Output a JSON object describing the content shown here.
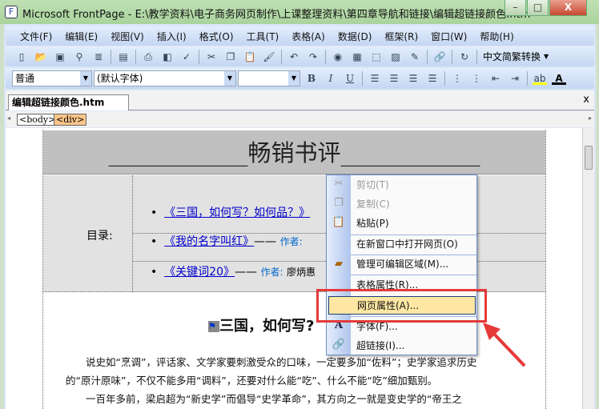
{
  "window": {
    "title": "Microsoft FrontPage - E:\\教学资料\\电子商务网页制作\\上课整理资料\\第四章导航和链接\\编辑超链接颜色.htm",
    "minimize": "–",
    "maximize": "□",
    "close": "X"
  },
  "menu": [
    "文件(F)",
    "编辑(E)",
    "视图(V)",
    "插入(I)",
    "格式(O)",
    "工具(T)",
    "表格(A)",
    "数据(D)",
    "框架(R)",
    "窗口(W)",
    "帮助(H)"
  ],
  "toolbar": {
    "convert_label": "中文简繁转换"
  },
  "format": {
    "style": "普通",
    "font": "(默认字体)",
    "size": "",
    "bold": "B",
    "italic": "I",
    "underline": "U"
  },
  "tab": {
    "label": "编辑超链接颜色.htm",
    "close": "x"
  },
  "tags": [
    "<body>",
    "<div>"
  ],
  "page": {
    "title": "____________畅销书评____________",
    "toc_label": "目录:",
    "links": [
      {
        "title": "《三国，如何写？如何品？》",
        "dash": "",
        "author_label": "",
        "author": ""
      },
      {
        "title": "《我的名字叫红》",
        "dash": "——",
        "author_label": "作者:",
        "author": ""
      },
      {
        "title": "《关键词20》",
        "dash": "——",
        "author_label": "作者:",
        "author": "廖炳惠"
      }
    ],
    "heading": "三国，如何写?",
    "paragraphs": [
      "　　说史如“烹调”，评话家、文学家要刺激受众的口味，一定要多加“佐料”；史学家追求历史",
      "的“原汁原味”，不仅不能多用“调料”，还要对什么能“吃”、什么不能“吃”细加甄别。",
      "　　一百年多前，梁启超为“新史学”而倡导“史学革命”，其方向之一就是变史学的“帝王之"
    ]
  },
  "context_menu": [
    {
      "label": "剪切(T)",
      "icon": "scissors-icon",
      "disabled": true
    },
    {
      "label": "复制(C)",
      "icon": "copy-icon",
      "disabled": true
    },
    {
      "label": "粘贴(P)",
      "icon": "paste-icon",
      "disabled": false
    },
    {
      "label": "在新窗口中打开网页(O)",
      "icon": "",
      "disabled": false
    },
    {
      "label": "管理可编辑区域(M)...",
      "icon": "region-icon",
      "disabled": false
    },
    {
      "label": "表格属性(R)...",
      "icon": "",
      "disabled": false
    },
    {
      "label": "网页属性(A)...",
      "icon": "",
      "disabled": false,
      "highlighted": true
    },
    {
      "label": "字体(F)...",
      "icon": "font-icon",
      "disabled": false
    },
    {
      "label": "超链接(I)...",
      "icon": "hyperlink-icon",
      "disabled": false
    }
  ],
  "colors": {
    "highlight": "#fde7a3",
    "annotation": "#e53a3a",
    "link": "#0000cc"
  }
}
